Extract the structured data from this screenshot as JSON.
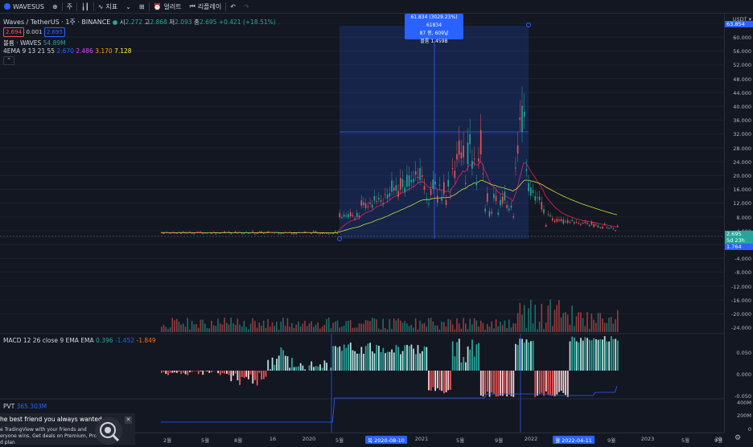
{
  "toolbar": {
    "symbol": "WAVESUS",
    "interval": "주",
    "indicators_label": "지표",
    "alert_label": "얼러트",
    "replay_label": "리플레이"
  },
  "legend": {
    "title": "Waves / TetherUS · 1주 · BINANCE",
    "open_label": "시",
    "open": "2.272",
    "high_label": "고",
    "high": "2.868",
    "low_label": "저",
    "low": "2.093",
    "close_label": "종",
    "close": "2.695",
    "change": "+0.421 (+18.51%)",
    "bid": "2.694",
    "spread": "0.001",
    "ask": "2.695",
    "volume_label": "볼륨 · WAVES",
    "volume_value": "54.89M",
    "ema_label": "4EMA 9 13 21 55",
    "ema_values": [
      "2.670",
      "2.486",
      "3.170",
      "7.128"
    ],
    "macd_label": "MACD 12 26 close 9 EMA EMA",
    "macd_values": [
      "0.396",
      "-1.452",
      "-1.849"
    ],
    "pvt_label": "PVT",
    "pvt_value": "365.303M"
  },
  "measure": {
    "line1": "61.834 (3029.23%) 61834",
    "line2": "87 봉, 609날",
    "line3": "볼륨 1.459B"
  },
  "price_axis": {
    "currency": "USDT ▾",
    "labels": [
      "60.000",
      "56.000",
      "52.000",
      "48.000",
      "44.000",
      "40.000",
      "36.000",
      "32.000",
      "28.000",
      "24.000",
      "20.000",
      "16.000",
      "12.000",
      "8.000",
      "4.000",
      "0.000",
      "-4.000",
      "-8.000",
      "-12.000",
      "-16.000",
      "-20.000",
      "-24.000"
    ],
    "tags": [
      "63.854",
      "2.695",
      "5d 23h",
      "1.764"
    ]
  },
  "macd_axis": [
    "0.050",
    "0.000",
    "-0.050"
  ],
  "pvt_axis": [
    "400M",
    "200M",
    "0"
  ],
  "time_axis": {
    "labels": [
      "2월",
      "5월",
      "8월",
      "16",
      "2020",
      "5월",
      "목 2020-08-10",
      "2021",
      "5월",
      "9월",
      "2022",
      "월 2022-04-11",
      "9월",
      "2023",
      "5월",
      "9월",
      "20"
    ]
  },
  "popup": {
    "headline": "he best friend you always wanted",
    "body1": "e TradingView with your friends and",
    "body2": "eryone wins. Get deals on Premium, Pro+,",
    "body3": "d plan"
  },
  "colors": {
    "up": "#26a69a",
    "down": "#ef5350",
    "accent": "#2962ff",
    "bg": "#131722"
  }
}
